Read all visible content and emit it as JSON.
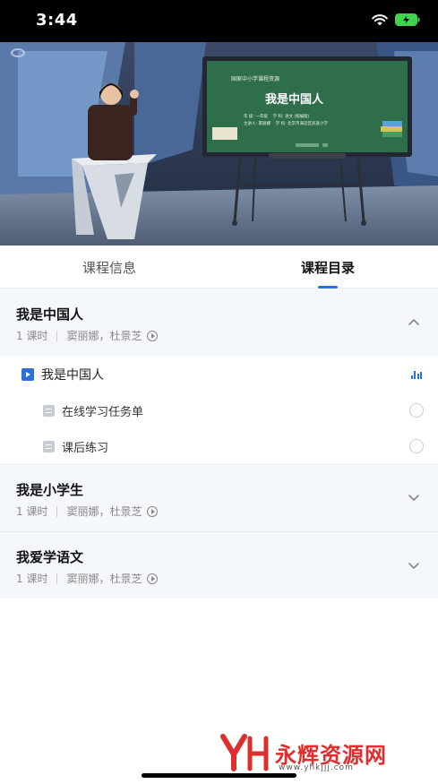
{
  "status_bar": {
    "time": "3:44"
  },
  "video": {
    "board_header": "国家中小学课程资源",
    "board_title": "我是中国人",
    "board_info_1": "年 级: 一年级    学 科: 语文 (统编版)",
    "board_info_2": "主讲人: 窦丽娜    学 校: 北京市海淀区民族小学"
  },
  "tabs": [
    {
      "label": "课程信息",
      "active": false
    },
    {
      "label": "课程目录",
      "active": true
    }
  ],
  "chapters": [
    {
      "title": "我是中国人",
      "hours": "1 课时",
      "teachers": "窦丽娜，杜景芝",
      "expanded": true,
      "lesson": {
        "title": "我是中国人"
      },
      "items": [
        {
          "title": "在线学习任务单"
        },
        {
          "title": "课后练习"
        }
      ]
    },
    {
      "title": "我是小学生",
      "hours": "1 课时",
      "teachers": "窦丽娜，杜景芝",
      "expanded": false
    },
    {
      "title": "我爱学语文",
      "hours": "1 课时",
      "teachers": "窦丽娜，杜景芝",
      "expanded": false
    }
  ],
  "watermark": {
    "text": "永辉资源网",
    "url": "www.yhkjjj.com"
  },
  "colors": {
    "accent": "#2a6fdb",
    "chapter_bg": "#f4f7fb",
    "watermark_red": "#e02d2d"
  },
  "icons": [
    "wifi-icon",
    "battery-icon",
    "chevron-up-icon",
    "chevron-down-icon",
    "play-circle-icon",
    "video-lesson-icon",
    "bar-chart-icon",
    "document-icon"
  ]
}
